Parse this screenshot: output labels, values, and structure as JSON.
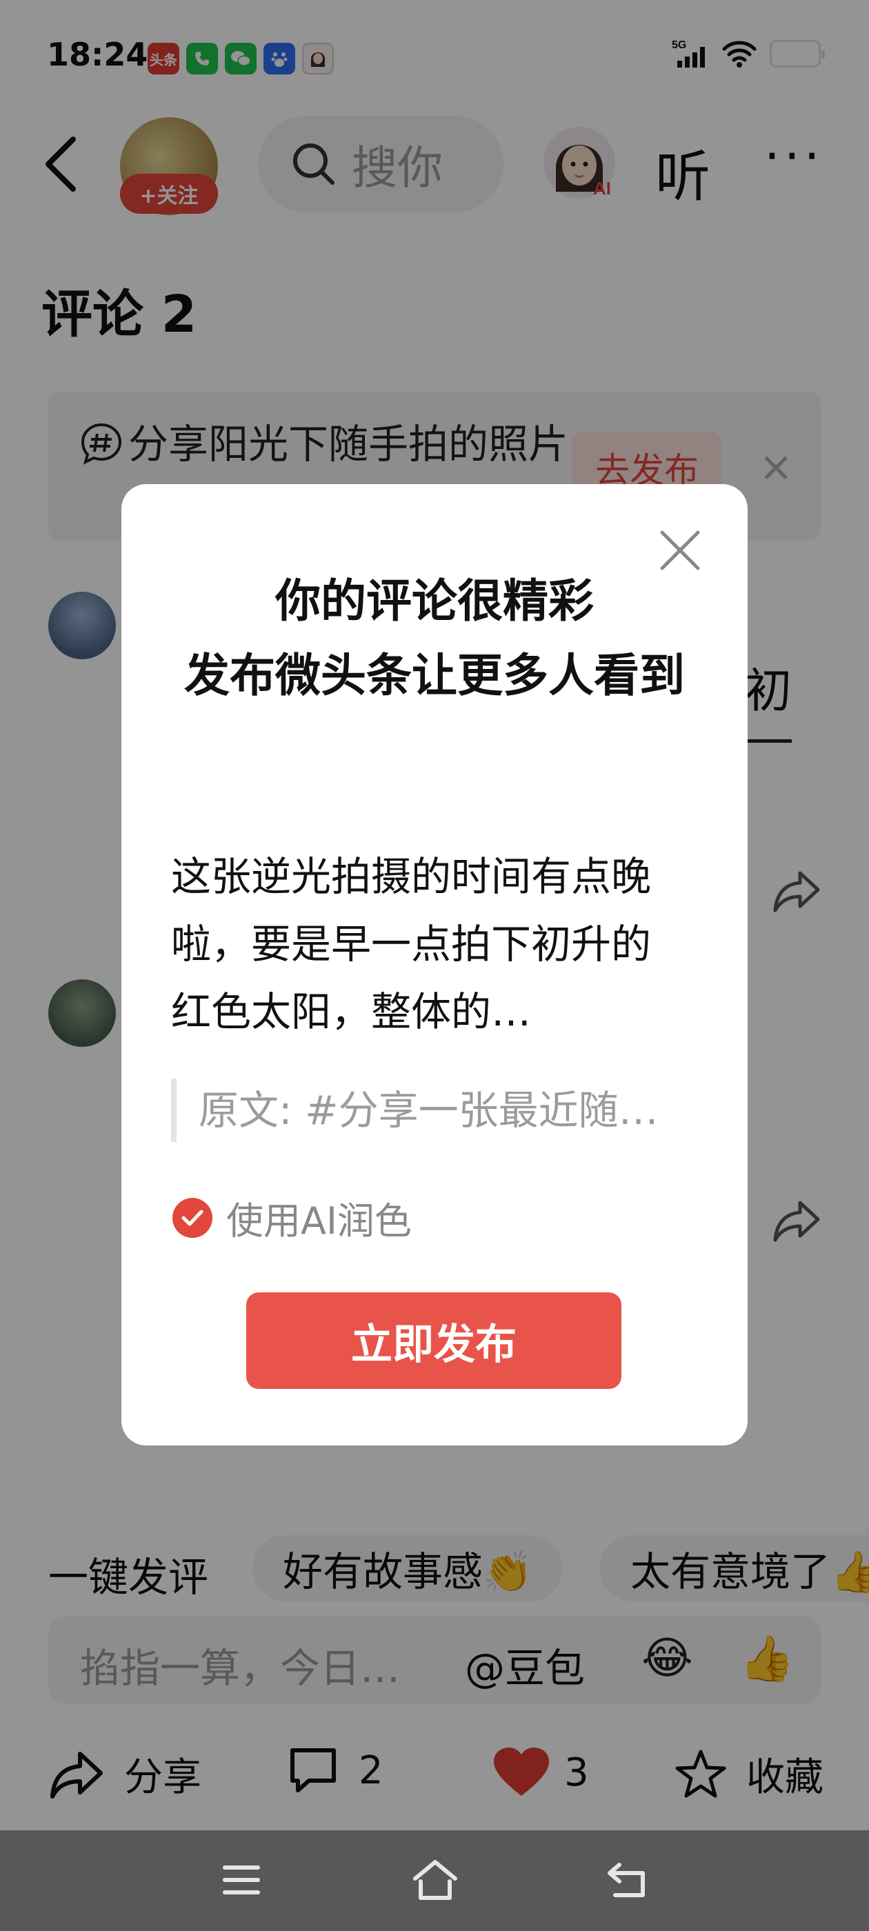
{
  "status_bar": {
    "time": "18:24",
    "app_icons": [
      "toutiao-icon",
      "phone-icon",
      "wechat-icon",
      "baidu-icon",
      "avatar-icon"
    ],
    "network": "5G",
    "toutiao_label": "头条"
  },
  "header": {
    "follow_label": "+关注",
    "search_placeholder": "搜你",
    "ai_badge": "AI",
    "listen_label": "听",
    "more_label": "···"
  },
  "comments_section": {
    "title": "评论 2",
    "topic_card": {
      "text": "分享阳光下随手拍的照片",
      "publish_label": "去发布",
      "close_label": "×"
    },
    "background_fragment": "初"
  },
  "quick_comments": {
    "label": "一键发评",
    "chips": [
      "好有故事感👏",
      "太有意境了👍"
    ]
  },
  "input_bar": {
    "placeholder": "掐指一算，今日…",
    "mention_label": "@豆包",
    "emoji_laugh": "😂",
    "emoji_thumb": "👍"
  },
  "action_bar": {
    "share_label": "分享",
    "comment_count": "2",
    "like_count": "3",
    "favorite_label": "收藏"
  },
  "dialog": {
    "title_line1": "你的评论很精彩",
    "title_line2": "发布微头条让更多人看到",
    "body_text": "这张逆光拍摄的时间有点晚啦，要是早一点拍下初升的红色太阳，整体的…",
    "quote_text": "原文: #分享一张最近随…",
    "checkbox_label": "使用AI润色",
    "checkbox_checked": true,
    "publish_button": "立即发布"
  },
  "colors": {
    "accent_red": "#e2463c",
    "publish_red": "#e9544a",
    "overlay": "rgba(0,0,0,0.42)",
    "system_nav": "#58585a"
  }
}
